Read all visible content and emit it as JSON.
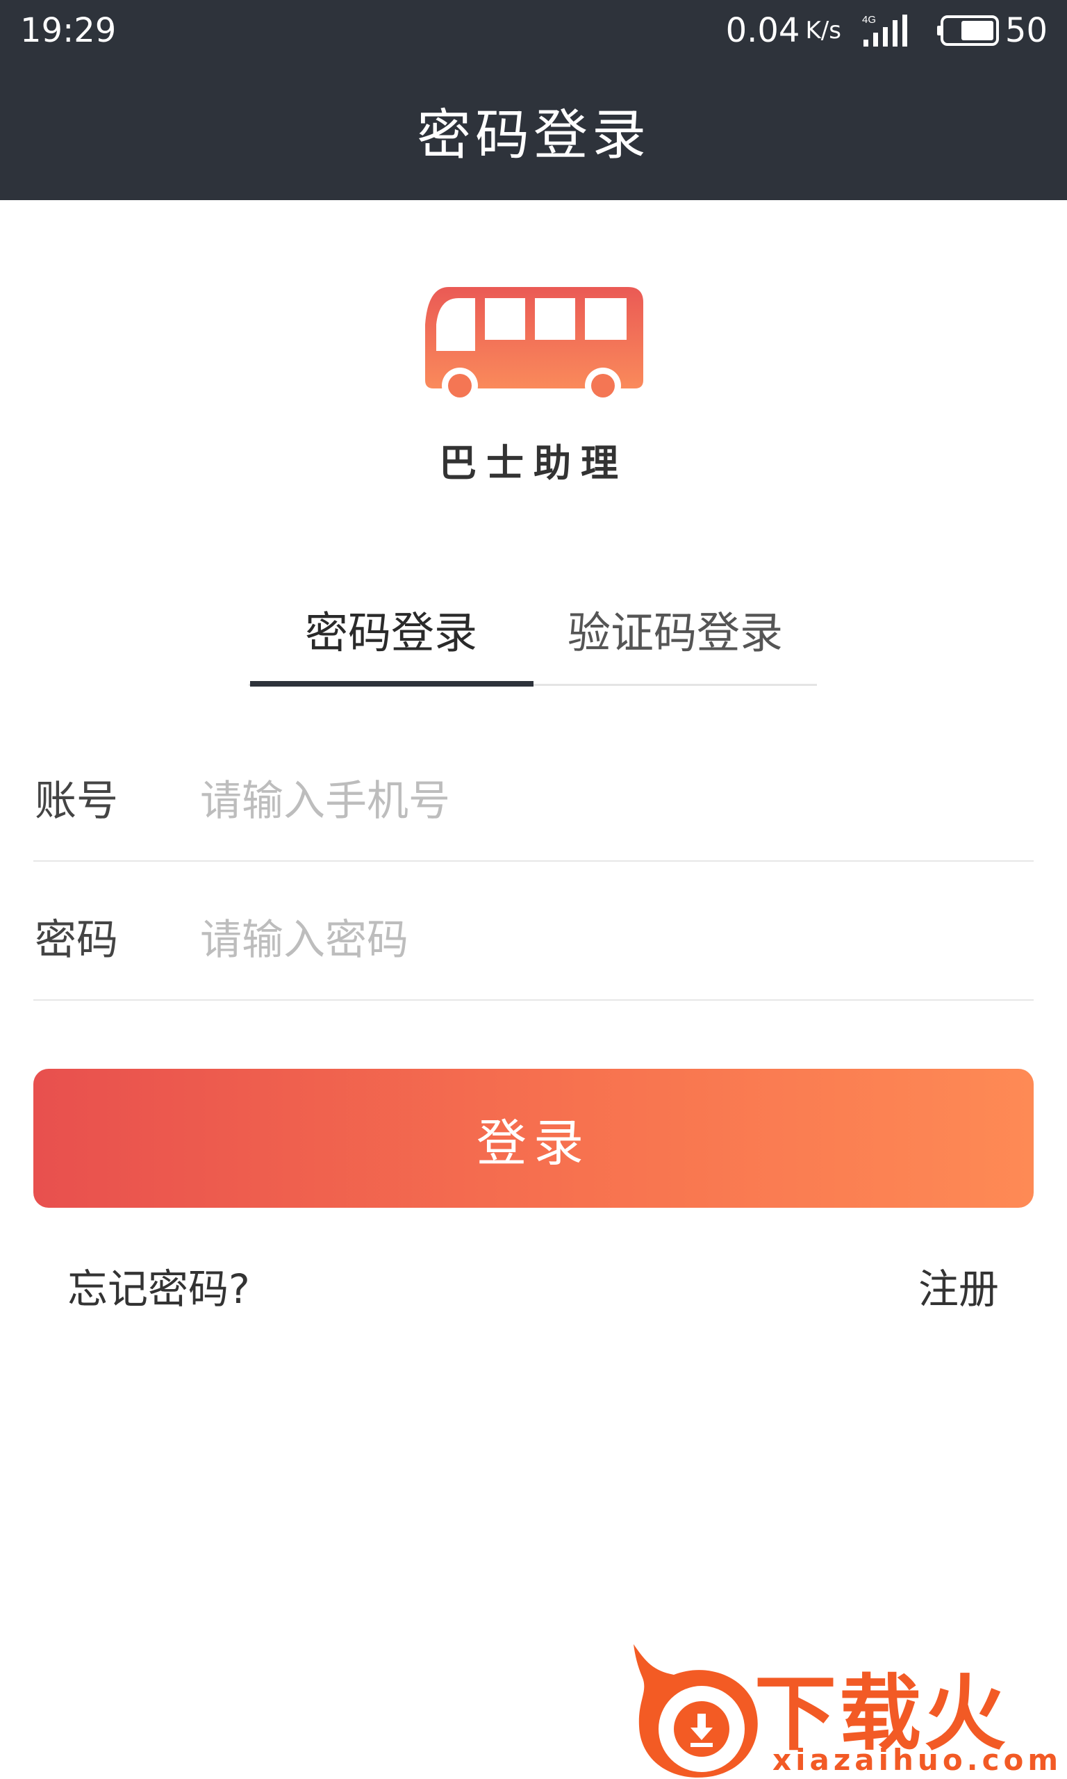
{
  "status_bar": {
    "time": "19:29",
    "net_speed": "0.04",
    "net_speed_unit": "K/s",
    "network_type": "4G",
    "battery": "50"
  },
  "nav": {
    "title": "密码登录"
  },
  "app": {
    "name": "巴士助理",
    "logo_icon": "bus-icon"
  },
  "tabs": {
    "items": [
      {
        "label": "密码登录",
        "active": true
      },
      {
        "label": "验证码登录",
        "active": false
      }
    ]
  },
  "form": {
    "account": {
      "label": "账号",
      "value": "",
      "placeholder": "请输入手机号"
    },
    "password": {
      "label": "密码",
      "value": "",
      "placeholder": "请输入密码"
    }
  },
  "actions": {
    "login_label": "登录",
    "forgot_label": "忘记密码?",
    "register_label": "注册"
  },
  "watermark": {
    "title": "下载火",
    "url": "xiazaihuo.com"
  },
  "colors": {
    "header_bg": "#2e333b",
    "accent_start": "#e8504e",
    "accent_end": "#fe8a55",
    "watermark": "#f25a25"
  }
}
